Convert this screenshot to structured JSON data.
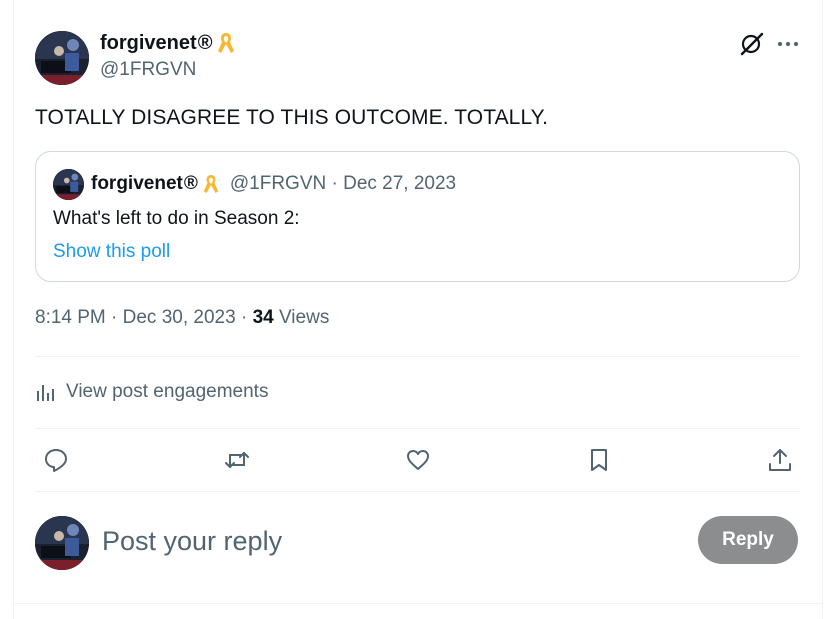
{
  "author": {
    "display_name": "forgivenet",
    "registered_mark": "®",
    "handle": "@1FRGVN",
    "badge_icon": "yellow-ribbon-icon"
  },
  "post": {
    "text": "TOTALLY DISAGREE TO THIS OUTCOME. TOTALLY."
  },
  "quoted_post": {
    "display_name": "forgivenet",
    "registered_mark": "®",
    "meta": "@1FRGVN · Dec 27, 2023",
    "text": "What's left to do in Season 2:",
    "link_label": "Show this poll"
  },
  "timestamp": {
    "time_date": "8:14 PM · Dec 30, 2023 · ",
    "views_count": "34",
    "views_label": " Views"
  },
  "engagements_label": "View post engagements",
  "actions": [
    "reply-icon",
    "repost-icon",
    "like-icon",
    "bookmark-icon",
    "share-icon"
  ],
  "reply_box": {
    "placeholder": "Post your reply",
    "button_label": "Reply"
  },
  "colors": {
    "link": "#1d9bf0",
    "secondary_text": "#536471",
    "reply_button_disabled": "#8b8d8f",
    "ribbon": "#f7b934"
  }
}
